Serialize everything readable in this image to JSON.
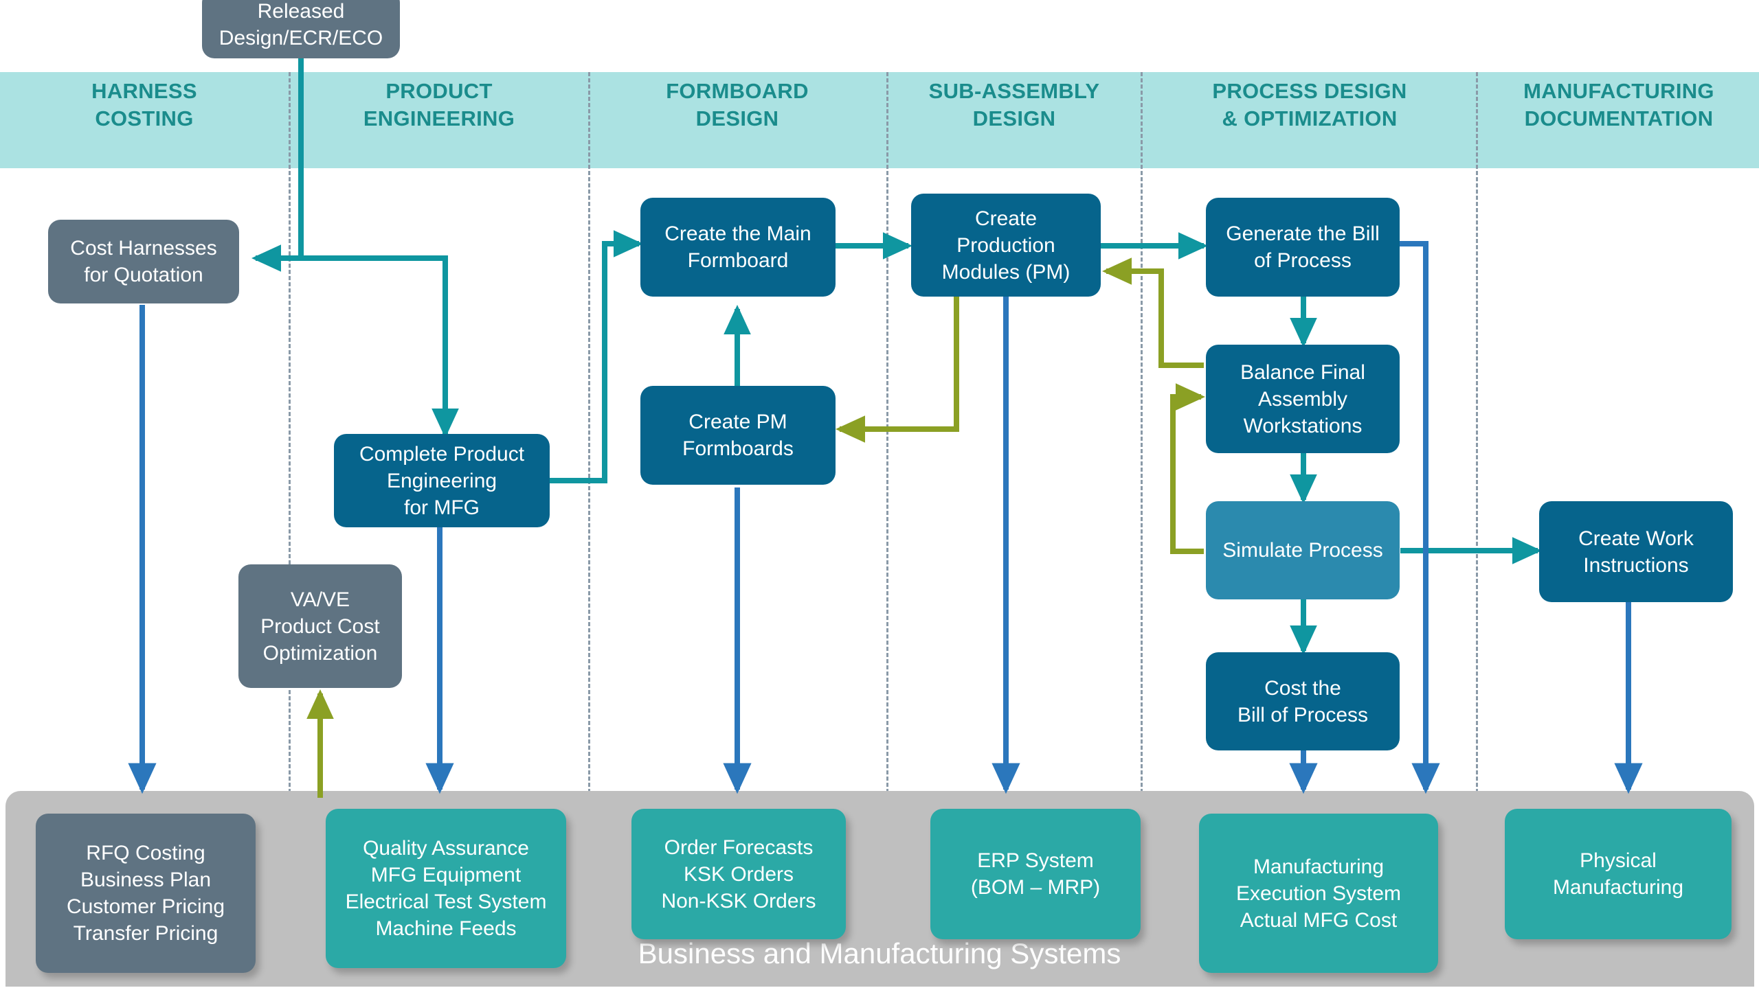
{
  "lanes": [
    {
      "id": "harness-costing",
      "label": "HARNESS\nCOSTING",
      "line1": "HARNESS",
      "line2": "COSTING"
    },
    {
      "id": "product-engineering",
      "label": "PRODUCT ENGINEERING",
      "line1": "PRODUCT",
      "line2": "ENGINEERING"
    },
    {
      "id": "formboard-design",
      "label": "FORMBOARD DESIGN",
      "line1": "FORMBOARD",
      "line2": "DESIGN"
    },
    {
      "id": "sub-assembly-design",
      "label": "SUB-ASSEMBLY DESIGN",
      "line1": "SUB-ASSEMBLY",
      "line2": "DESIGN"
    },
    {
      "id": "process-design",
      "label": "PROCESS DESIGN & OPTIMIZATION",
      "line1": "PROCESS DESIGN",
      "line2": "& OPTIMIZATION"
    },
    {
      "id": "manufacturing-documentation",
      "label": "MANUFACTURING DOCUMENTATION",
      "line1": "MANUFACTURING",
      "line2": "DOCUMENTATION"
    }
  ],
  "nodes": {
    "released_design": {
      "line1": "Released",
      "line2": "Design/ECR/ECO"
    },
    "cost_harnesses": {
      "line1": "Cost Harnesses",
      "line2": "for Quotation"
    },
    "complete_product_engineering": {
      "line1": "Complete Product",
      "line2": "Engineering",
      "line3": "for MFG"
    },
    "vave": {
      "line1": "VA/VE",
      "line2": "Product Cost",
      "line3": "Optimization"
    },
    "create_main_formboard": {
      "line1": "Create the Main",
      "line2": "Formboard"
    },
    "create_pm_formboards": {
      "line1": "Create PM",
      "line2": "Formboards"
    },
    "create_production_modules": {
      "line1": "Create",
      "line2": "Production",
      "line3": "Modules (PM)"
    },
    "generate_bill_of_process": {
      "line1": "Generate the Bill",
      "line2": "of Process"
    },
    "balance_final_assembly": {
      "line1": "Balance Final",
      "line2": "Assembly",
      "line3": "Workstations"
    },
    "simulate_process": {
      "line1": "Simulate Process"
    },
    "cost_bill_of_process": {
      "line1": "Cost the",
      "line2": "Bill of Process"
    },
    "create_work_instructions": {
      "line1": "Create Work",
      "line2": "Instructions"
    }
  },
  "systems_band": {
    "title": "Business and Manufacturing Systems",
    "items": {
      "rfq_costing": {
        "line1": "RFQ Costing",
        "line2": "Business Plan",
        "line3": "Customer Pricing",
        "line4": "Transfer Pricing"
      },
      "quality_assurance": {
        "line1": "Quality Assurance",
        "line2": "MFG Equipment",
        "line3": "Electrical Test System",
        "line4": "Machine Feeds"
      },
      "order_forecasts": {
        "line1": "Order Forecasts",
        "line2": "KSK Orders",
        "line3": "Non-KSK Orders"
      },
      "erp_system": {
        "line1": "ERP System",
        "line2": "(BOM – MRP)"
      },
      "manufacturing_execution": {
        "line1": "Manufacturing",
        "line2": "Execution System",
        "line3": "Actual MFG Cost"
      },
      "physical_manufacturing": {
        "line1": "Physical",
        "line2": "Manufacturing"
      }
    }
  },
  "colors": {
    "lane_band": "#abe2e2",
    "lane_title": "#1a8c8c",
    "grey_node": "#5f7382",
    "navy_node": "#06648c",
    "light_blue_node": "#2b8aae",
    "teal_system_node": "#2ba9a6",
    "systems_band": "#bfbfbf",
    "teal_connector": "#0f96a0",
    "green_connector": "#8ba024",
    "blue_connector": "#2b77bc",
    "divider": "#8a9aa8"
  }
}
